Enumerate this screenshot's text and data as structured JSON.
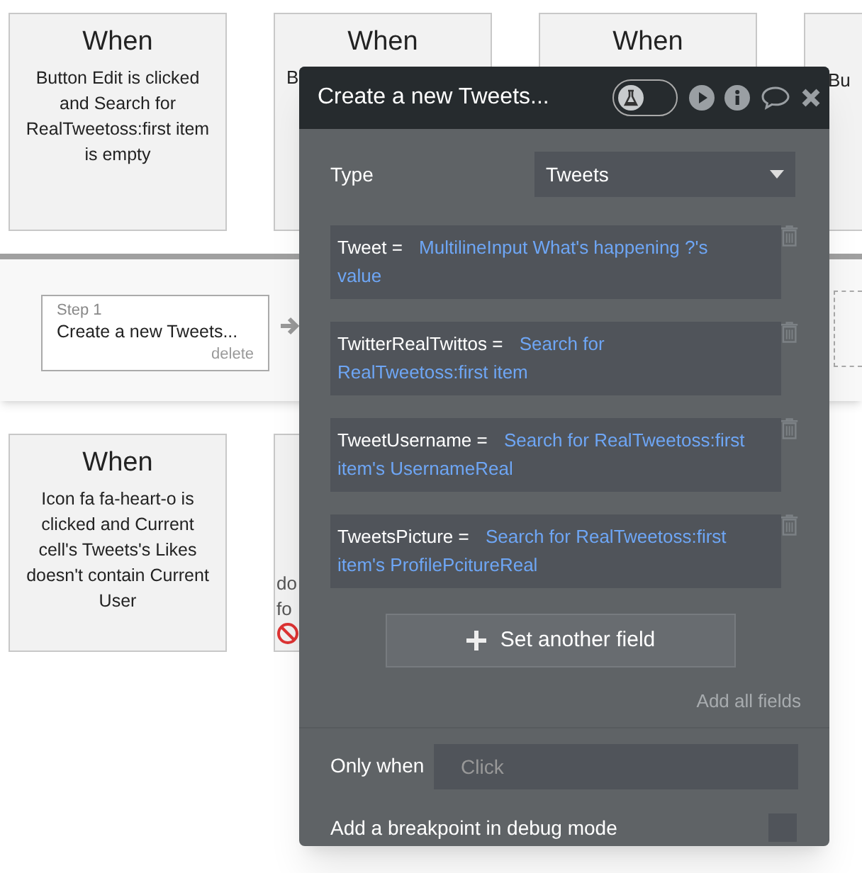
{
  "canvas": {
    "events_top": [
      {
        "title": "When",
        "lines": [
          "Button Edit is clicked and Search for RealTweetoss:first item is empty"
        ]
      },
      {
        "title": "When",
        "lines": [
          "B"
        ]
      },
      {
        "title": "When"
      },
      {
        "lines": [
          "Bu"
        ]
      }
    ],
    "step": {
      "label": "Step 1",
      "name": "Create a new Tweets...",
      "delete": "delete"
    },
    "events_bottom": [
      {
        "title": "When",
        "lines": [
          "Icon fa fa-heart-o is clicked and Current cell's Tweets's Likes doesn't contain Current User"
        ]
      },
      {
        "lines": [
          "do",
          "fo"
        ],
        "blocked": true
      }
    ]
  },
  "panel": {
    "title": "Create a new Tweets...",
    "debug_toggle": {
      "on": false
    },
    "type": {
      "label": "Type",
      "value": "Tweets"
    },
    "fields": [
      {
        "name": "Tweet",
        "operator": "=",
        "value": "MultilineInput What's happening ?'s value"
      },
      {
        "name": "TwitterRealTwittos",
        "operator": "=",
        "value": "Search for RealTweetoss:first item"
      },
      {
        "name": "TweetUsername",
        "operator": "=",
        "value": "Search for RealTweetoss:first item's UsernameReal"
      },
      {
        "name": "TweetsPicture",
        "operator": "=",
        "value": "Search for RealTweetoss:first item's ProfilePcitureReal"
      }
    ],
    "add_button": "Set another field",
    "add_all": "Add all fields",
    "only_when": {
      "label": "Only when",
      "placeholder": "Click"
    },
    "breakpoint": {
      "label": "Add a breakpoint in debug mode",
      "checked": false
    }
  }
}
